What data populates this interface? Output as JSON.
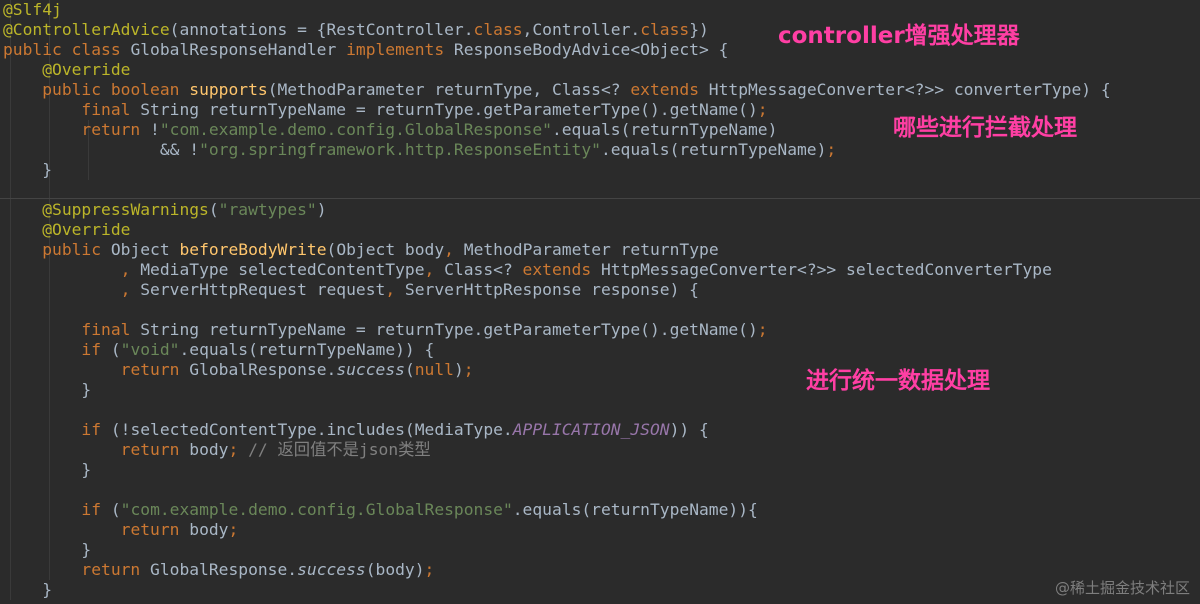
{
  "code": {
    "lines": [
      [
        {
          "t": "@Slf4j",
          "c": "ann"
        }
      ],
      [
        {
          "t": "@ControllerAdvice",
          "c": "ann"
        },
        {
          "t": "(annotations = {"
        },
        {
          "t": "RestController.",
          "c": ""
        },
        {
          "t": "class",
          "c": "kw"
        },
        {
          "t": ",Controller."
        },
        {
          "t": "class",
          "c": "kw"
        },
        {
          "t": "})"
        }
      ],
      [
        {
          "t": "public class ",
          "c": "kw"
        },
        {
          "t": "GlobalResponseHandler "
        },
        {
          "t": "implements ",
          "c": "kw"
        },
        {
          "t": "ResponseBodyAdvice<Object> {"
        }
      ],
      [
        {
          "t": "    "
        },
        {
          "t": "@Override",
          "c": "ann"
        }
      ],
      [
        {
          "t": "    "
        },
        {
          "t": "public boolean ",
          "c": "kw"
        },
        {
          "t": "supports",
          "c": "fn"
        },
        {
          "t": "(MethodParameter returnType, Class<? "
        },
        {
          "t": "extends ",
          "c": "kw"
        },
        {
          "t": "HttpMessageConverter<?>> converterType) {"
        }
      ],
      [
        {
          "t": "        "
        },
        {
          "t": "final ",
          "c": "kw"
        },
        {
          "t": "String returnTypeName = returnType.getParameterType().getName()"
        },
        {
          "t": ";",
          "c": "kw"
        }
      ],
      [
        {
          "t": "        "
        },
        {
          "t": "return ",
          "c": "kw"
        },
        {
          "t": "!"
        },
        {
          "t": "\"com.example.demo.config.GlobalResponse\"",
          "c": "str"
        },
        {
          "t": ".equals(returnTypeName)"
        }
      ],
      [
        {
          "t": "                "
        },
        {
          "t": "&& !"
        },
        {
          "t": "\"org.springframework.http.ResponseEntity\"",
          "c": "str"
        },
        {
          "t": ".equals(returnTypeName)"
        },
        {
          "t": ";",
          "c": "kw"
        }
      ],
      [
        {
          "t": "    }"
        }
      ],
      [
        {
          "t": ""
        }
      ],
      [
        {
          "t": "    "
        },
        {
          "t": "@SuppressWarnings",
          "c": "ann"
        },
        {
          "t": "("
        },
        {
          "t": "\"rawtypes\"",
          "c": "str"
        },
        {
          "t": ")"
        }
      ],
      [
        {
          "t": "    "
        },
        {
          "t": "@Override",
          "c": "ann"
        }
      ],
      [
        {
          "t": "    "
        },
        {
          "t": "public ",
          "c": "kw"
        },
        {
          "t": "Object "
        },
        {
          "t": "beforeBodyWrite",
          "c": "fn"
        },
        {
          "t": "(Object body"
        },
        {
          "t": ", ",
          "c": "kw"
        },
        {
          "t": "MethodParameter returnType"
        }
      ],
      [
        {
          "t": "            "
        },
        {
          "t": ", ",
          "c": "kw"
        },
        {
          "t": "MediaType selectedContentType"
        },
        {
          "t": ", ",
          "c": "kw"
        },
        {
          "t": "Class<? "
        },
        {
          "t": "extends ",
          "c": "kw"
        },
        {
          "t": "HttpMessageConverter<?>> selectedConverterType"
        }
      ],
      [
        {
          "t": "            "
        },
        {
          "t": ", ",
          "c": "kw"
        },
        {
          "t": "ServerHttpRequest request"
        },
        {
          "t": ", ",
          "c": "kw"
        },
        {
          "t": "ServerHttpResponse response) {"
        }
      ],
      [
        {
          "t": ""
        }
      ],
      [
        {
          "t": "        "
        },
        {
          "t": "final ",
          "c": "kw"
        },
        {
          "t": "String returnTypeName = returnType.getParameterType().getName()"
        },
        {
          "t": ";",
          "c": "kw"
        }
      ],
      [
        {
          "t": "        "
        },
        {
          "t": "if ",
          "c": "kw"
        },
        {
          "t": "("
        },
        {
          "t": "\"void\"",
          "c": "str"
        },
        {
          "t": ".equals(returnTypeName)) {"
        }
      ],
      [
        {
          "t": "            "
        },
        {
          "t": "return ",
          "c": "kw"
        },
        {
          "t": "GlobalResponse."
        },
        {
          "t": "success",
          "c": "it"
        },
        {
          "t": "("
        },
        {
          "t": "null",
          "c": "kw"
        },
        {
          "t": ")"
        },
        {
          "t": ";",
          "c": "kw"
        }
      ],
      [
        {
          "t": "        }"
        }
      ],
      [
        {
          "t": ""
        }
      ],
      [
        {
          "t": "        "
        },
        {
          "t": "if ",
          "c": "kw"
        },
        {
          "t": "(!selectedContentType.includes(MediaType."
        },
        {
          "t": "APPLICATION_JSON",
          "c": "cst"
        },
        {
          "t": ")) {"
        }
      ],
      [
        {
          "t": "            "
        },
        {
          "t": "return ",
          "c": "kw"
        },
        {
          "t": "body"
        },
        {
          "t": "; ",
          "c": "kw"
        },
        {
          "t": "// 返回值不是json类型",
          "c": "cmt"
        }
      ],
      [
        {
          "t": "        }"
        }
      ],
      [
        {
          "t": ""
        }
      ],
      [
        {
          "t": "        "
        },
        {
          "t": "if ",
          "c": "kw"
        },
        {
          "t": "("
        },
        {
          "t": "\"com.example.demo.config.GlobalResponse\"",
          "c": "str"
        },
        {
          "t": ".equals(returnTypeName)){"
        }
      ],
      [
        {
          "t": "            "
        },
        {
          "t": "return ",
          "c": "kw"
        },
        {
          "t": "body"
        },
        {
          "t": ";",
          "c": "kw"
        }
      ],
      [
        {
          "t": "        }"
        }
      ],
      [
        {
          "t": "        "
        },
        {
          "t": "return ",
          "c": "kw"
        },
        {
          "t": "GlobalResponse."
        },
        {
          "t": "success",
          "c": "it"
        },
        {
          "t": "(body)"
        },
        {
          "t": ";",
          "c": "kw"
        }
      ],
      [
        {
          "t": "    }"
        }
      ]
    ]
  },
  "annotations": {
    "controller_enhancer": "controller增强处理器",
    "which_intercept": "哪些进行拦截处理",
    "unified_processing": "进行统一数据处理"
  },
  "watermark": "@稀土掘金技术社区",
  "colors": {
    "background": "#2b2b2b",
    "keyword": "#cc7832",
    "string": "#6a8759",
    "annotation": "#bbb529",
    "method": "#ffc66d",
    "constant": "#9876aa",
    "comment": "#808080",
    "note": "#ff3fa4"
  }
}
